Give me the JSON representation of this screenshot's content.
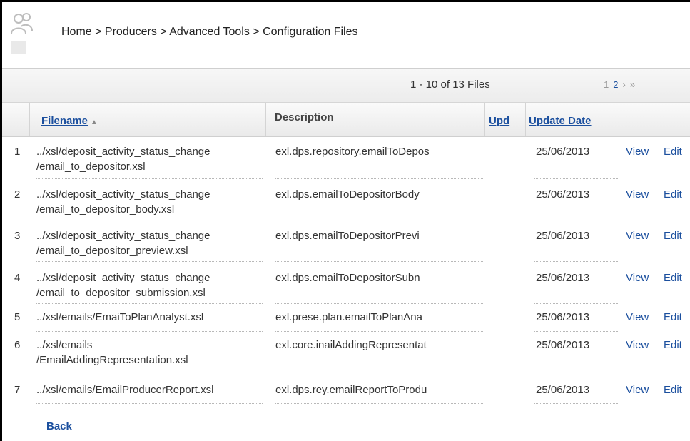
{
  "breadcrumb": "Home > Producers > Advanced Tools > Configuration Files",
  "pager": {
    "count": "1 - 10 of 13 Files",
    "pages": [
      "1",
      "2"
    ],
    "next": "›",
    "last": "»"
  },
  "columns": {
    "filename": "Filename",
    "description": "Description",
    "upd": "Upd",
    "update_date": "Update Date"
  },
  "rows": [
    {
      "num": "1",
      "file1": "../xsl/deposit_activity_status_change",
      "file2": "/email_to_depositor.xsl",
      "description": "exl.dps.repository.emailToDepos",
      "date": "25/06/2013",
      "view": "View",
      "edit": "Edit"
    },
    {
      "num": "2",
      "file1": "../xsl/deposit_activity_status_change",
      "file2": "/email_to_depositor_body.xsl",
      "description": "exl.dps.emailToDepositorBody",
      "date": "25/06/2013",
      "view": "View",
      "edit": "Edit"
    },
    {
      "num": "3",
      "file1": "../xsl/deposit_activity_status_change",
      "file2": "/email_to_depositor_preview.xsl",
      "description": "exl.dps.emailToDepositorPrevi",
      "date": "25/06/2013",
      "view": "View",
      "edit": "Edit"
    },
    {
      "num": "4",
      "file1": "../xsl/deposit_activity_status_change",
      "file2": "/email_to_depositor_submission.xsl",
      "description": "exl.dps.emailToDepositorSubn",
      "date": "25/06/2013",
      "view": "View",
      "edit": "Edit"
    },
    {
      "num": "5",
      "file1": "../xsl/emails/EmaiToPlanAnalyst.xsl",
      "file2": "",
      "description": "exl.prese.plan.emailToPlanAna",
      "date": "25/06/2013",
      "view": "View",
      "edit": "Edit"
    },
    {
      "num": "6",
      "file1": "../xsl/emails",
      "file2": "/EmailAddingRepresentation.xsl",
      "description": "exl.core.inailAddingRepresentat",
      "date": "25/06/2013",
      "view": "View",
      "edit": "Edit"
    },
    {
      "num": "7",
      "file1": "../xsl/emails/EmailProducerReport.xsl",
      "file2": "",
      "description": "exl.dps.rey.emailReportToProdu",
      "date": "25/06/2013",
      "view": "View",
      "edit": "Edit"
    }
  ],
  "back": "Back"
}
